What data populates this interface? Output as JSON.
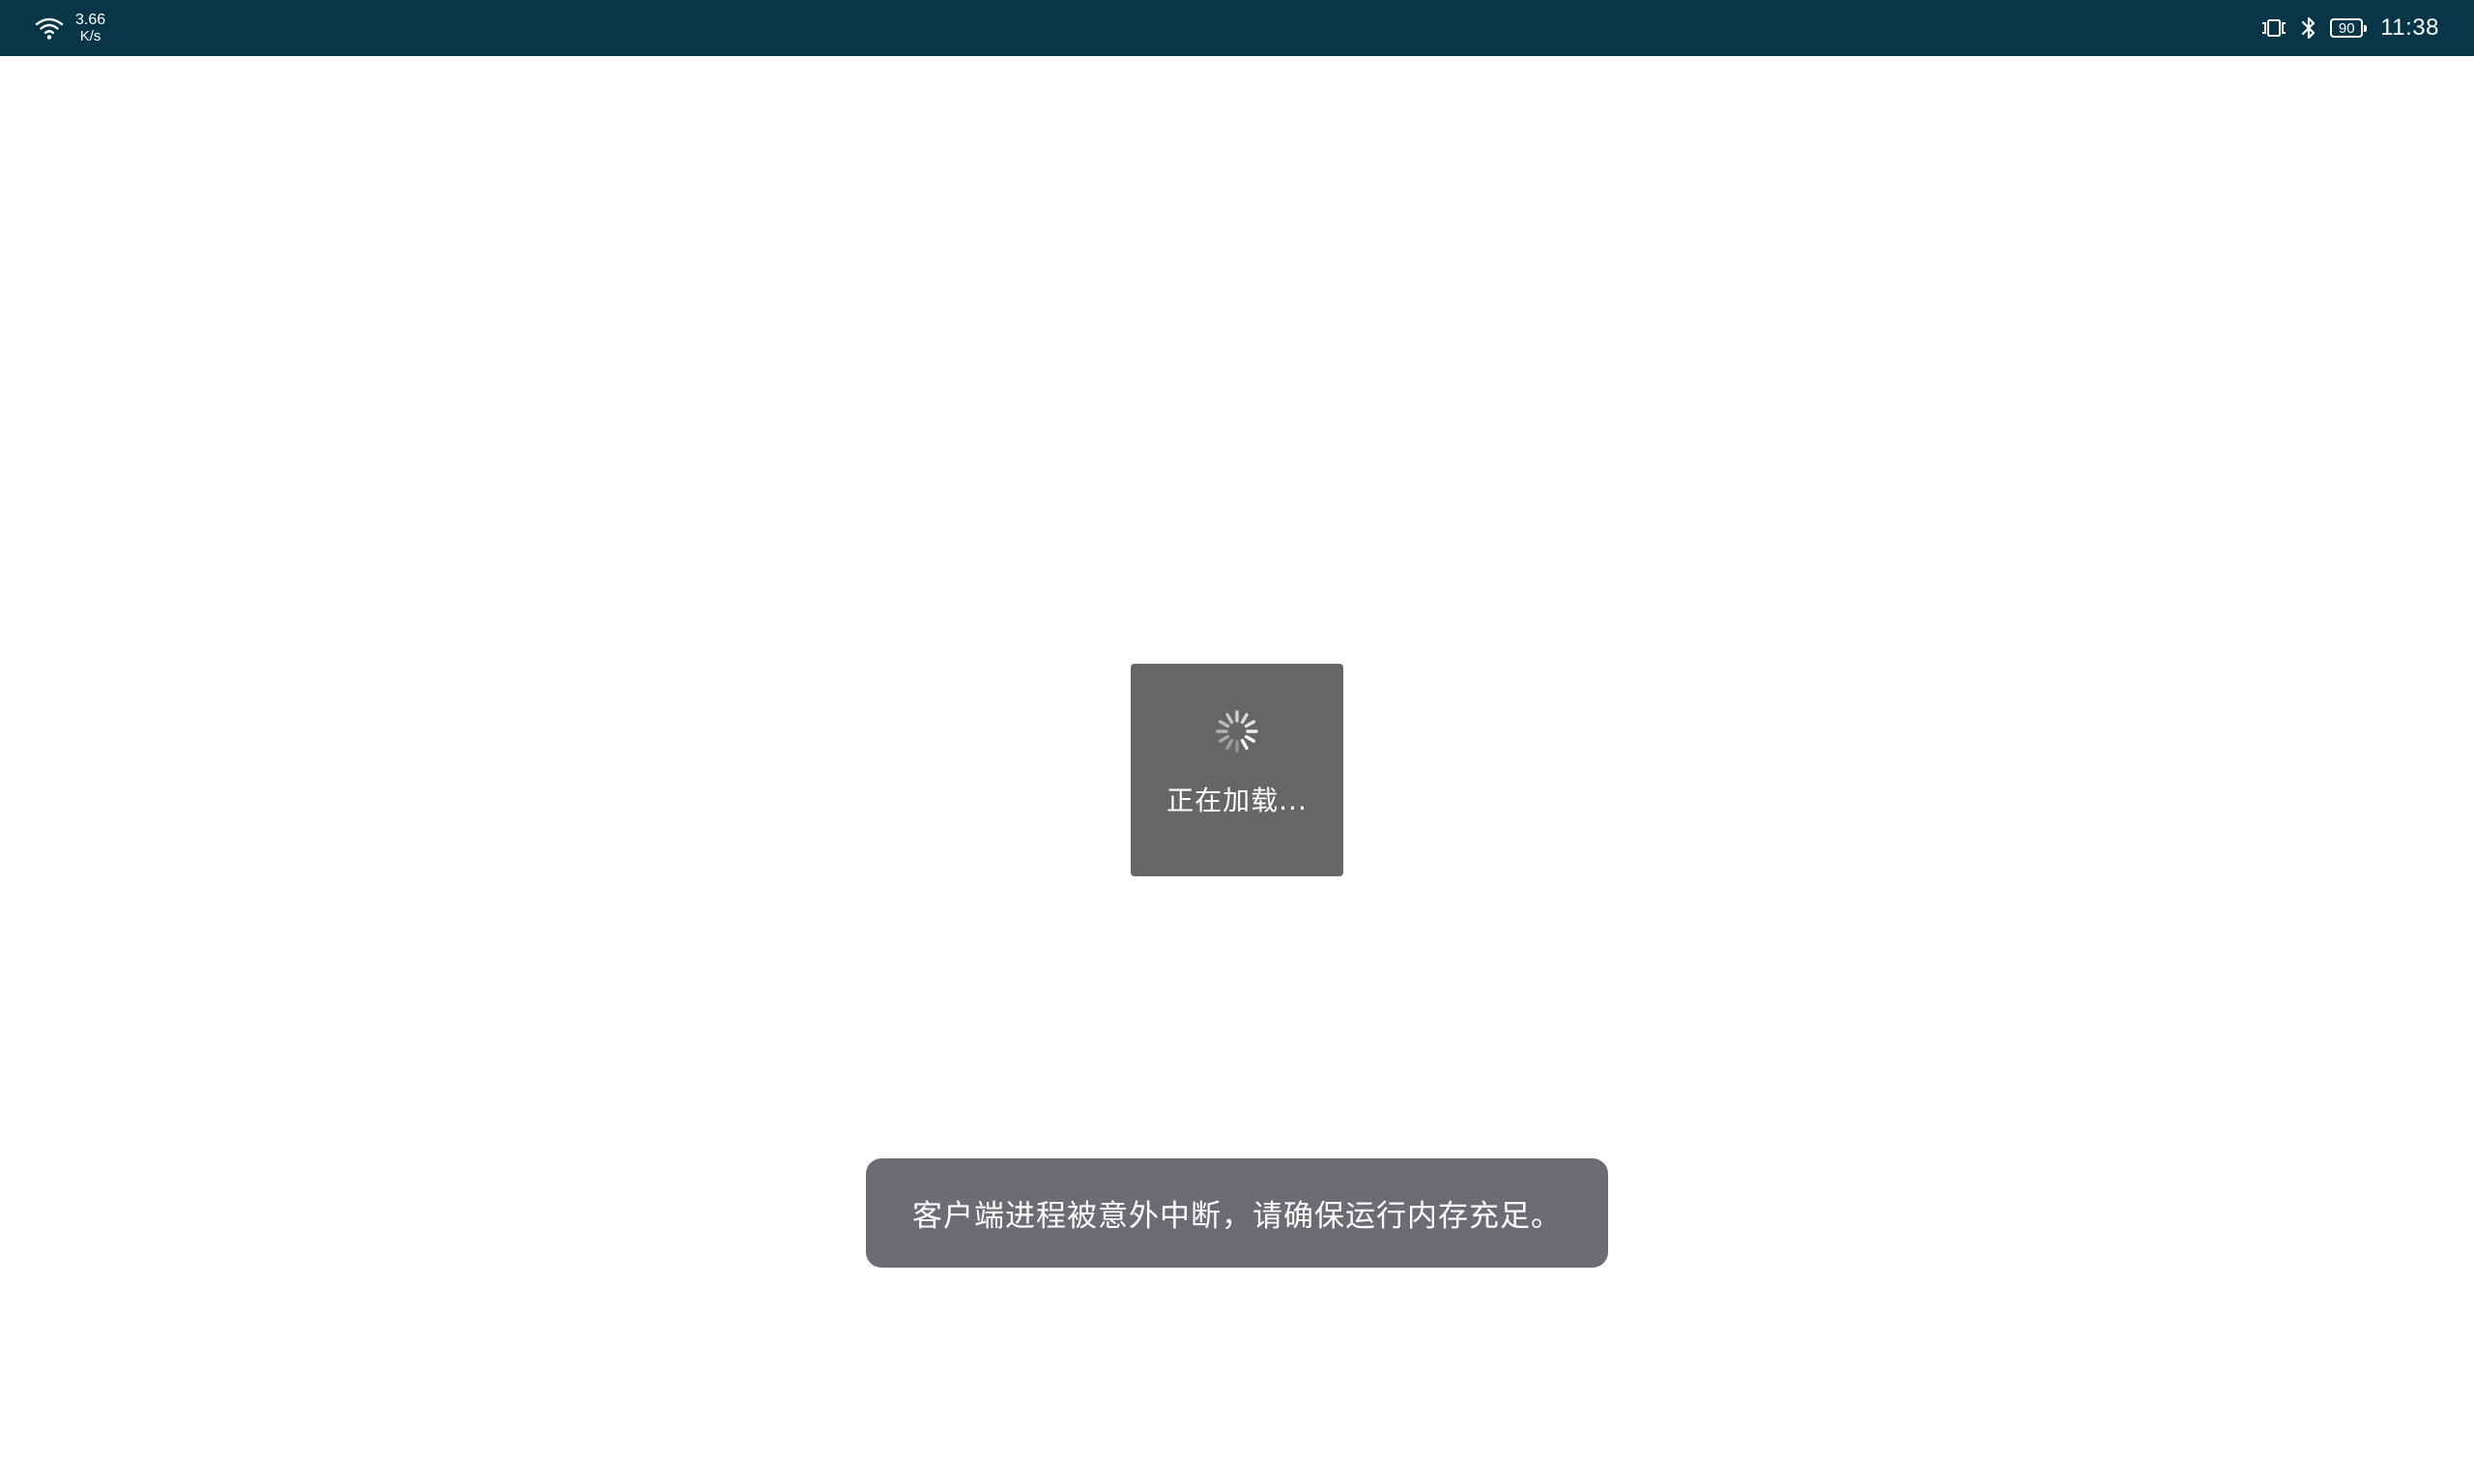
{
  "status_bar": {
    "net_speed_value": "3.66",
    "net_speed_unit": "K/s",
    "battery_level": "90",
    "time": "11:38",
    "icons": [
      "wifi-icon",
      "vibrate-icon",
      "bluetooth-icon",
      "battery-icon"
    ]
  },
  "loading": {
    "text": "正在加载..."
  },
  "toast": {
    "message": "客户端进程被意外中断，请确保运行内存充足。"
  },
  "colors": {
    "status_bar_bg": "#083547",
    "loading_box_bg": "#666666",
    "toast_bg": "#6b6d73",
    "page_bg": "#ffffff"
  }
}
